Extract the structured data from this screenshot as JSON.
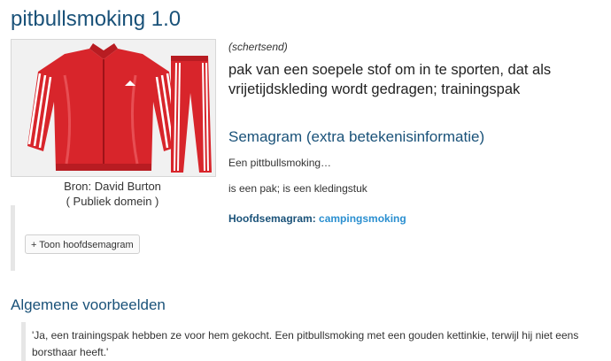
{
  "page_title": "pitbullsmoking 1.0",
  "image": {
    "alt_subject": "red-tracksuit",
    "credit": "Bron: David Burton",
    "license": "( Publiek domein )"
  },
  "buttons": {
    "toon_hoofdsemagram": "+ Toon hoofdsemagram"
  },
  "meaning": {
    "register": "(schertsend)",
    "definition": "pak van een soepele stof om in te sporten, dat als vrijetijdskleding wordt gedragen; trainingspak"
  },
  "semagram": {
    "title": "Semagram (extra betekenisinformatie)",
    "line1": "Een pittbullsmoking…",
    "line2": "is een pak; is een kledingstuk",
    "hoofd_label": "Hoofdsemagram:",
    "hoofd_link": "campingsmoking"
  },
  "examples": {
    "title": "Algemene voorbeelden",
    "quote": "'Ja, een trainingspak hebben ze voor hem gekocht. Een pitbullsmoking met een gouden kettinkie, terwijl hij niet eens borsthaar heeft.'"
  },
  "colors": {
    "heading": "#1a5279",
    "link": "#2a8fd0",
    "tracksuit_red": "#d8252b"
  }
}
